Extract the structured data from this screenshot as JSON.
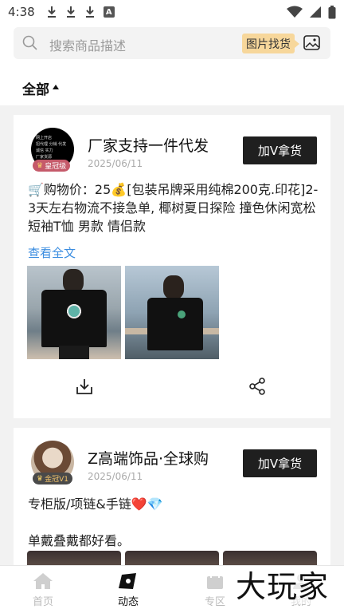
{
  "status_bar": {
    "time": "4:38",
    "notification_a": "A"
  },
  "search": {
    "placeholder": "搜索商品描述",
    "image_search_label": "图片找货"
  },
  "filter": {
    "label": "全部"
  },
  "posts": [
    {
      "name": "厂家支持一件代发",
      "date": "2025/06/11",
      "badge": "皇冠级",
      "button": "加V拿货",
      "avatar_text": [
        "网上开店",
        "招代理 分销 代发",
        "诚信 实力",
        "厂家货源"
      ],
      "text": "🛒购物价：25💰[包装吊牌采用纯棉200克.印花]2-3天左右物流不接急单, 椰树夏日探险 撞色休闲宽松短袖T恤 男款 情侣款",
      "view_all": "查看全文"
    },
    {
      "name": "Z高端饰品·全球购",
      "date": "2025/06/11",
      "badge": "金冠V1",
      "button": "加V拿货",
      "line1_text": "专柜版/项链&手链",
      "line1_heart": "❤️",
      "line1_gem": "💎",
      "line2": "单戴叠戴都好看。"
    }
  ],
  "tabbar": {
    "home": "首页",
    "feed": "动态",
    "zone": "专区",
    "me": "我的"
  },
  "watermark": "大玩家",
  "colors": {
    "accent_blue": "#3b8de0",
    "button_dark": "#1f1f1f",
    "image_search_bg": "#f7d79b"
  }
}
